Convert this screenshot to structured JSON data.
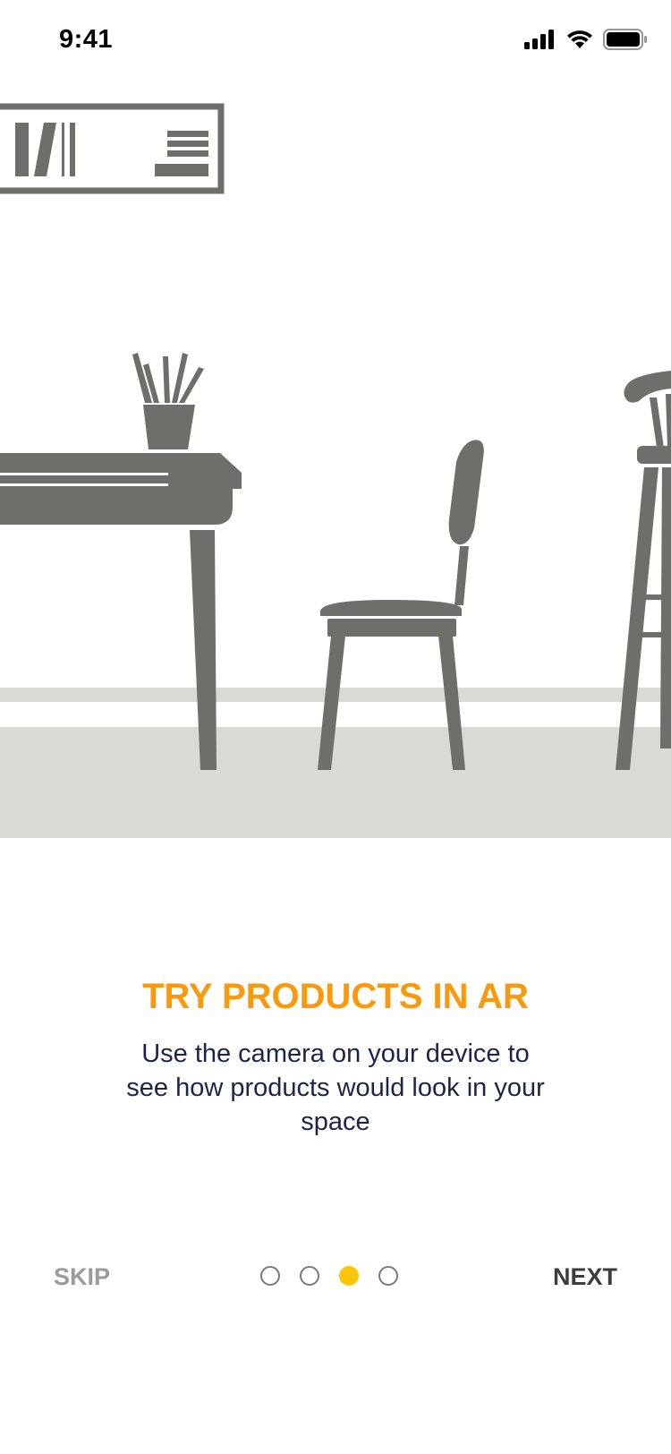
{
  "status_bar": {
    "time": "9:41"
  },
  "onboarding": {
    "title": "TRY PRODUCTS IN AR",
    "description": "Use the camera on your device to see how products would look in your space",
    "skip_label": "SKIP",
    "next_label": "NEXT",
    "page_count": 4,
    "current_page": 3
  },
  "icons": [
    "cellular-signal-icon",
    "wifi-icon",
    "battery-icon"
  ],
  "colors": {
    "accent": "#F99A0E",
    "dot_active": "#FBC50A",
    "furniture": "#6E6E6A",
    "floor": "#D9DAD5",
    "description_text": "#1E2448",
    "skip_text": "#9B9B9B",
    "next_text": "#3C3C3C"
  }
}
